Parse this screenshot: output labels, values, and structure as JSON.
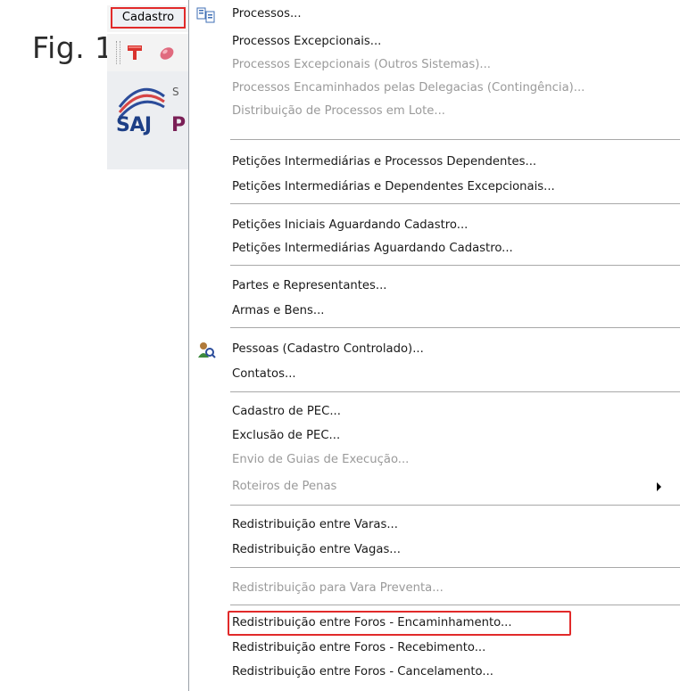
{
  "figure_label": "Fig. 1",
  "menubar": {
    "active_menu": "Cadastro"
  },
  "app": {
    "logo_text": "SAJ",
    "logo_side_s": "S",
    "logo_side_p": "P"
  },
  "dropdown": {
    "items": [
      {
        "label": "Processos...",
        "enabled": true,
        "icon": "process-list-icon"
      },
      {
        "label": "Processos Excepcionais...",
        "enabled": true
      },
      {
        "label": "Processos Excepcionais (Outros Sistemas)...",
        "enabled": false
      },
      {
        "label": "Processos Encaminhados pelas Delegacias (Contingência)...",
        "enabled": false
      },
      {
        "label": "Distribuição de Processos em Lote...",
        "enabled": false
      },
      {
        "label": "Petições Intermediárias e Processos Dependentes...",
        "enabled": true
      },
      {
        "label": "Petições Intermediárias e Dependentes Excepcionais...",
        "enabled": true
      },
      {
        "label": "Petições Iniciais Aguardando Cadastro...",
        "enabled": true
      },
      {
        "label": "Petições Intermediárias Aguardando Cadastro...",
        "enabled": true
      },
      {
        "label": "Partes e Representantes...",
        "enabled": true
      },
      {
        "label": "Armas e Bens...",
        "enabled": true
      },
      {
        "label": "Pessoas (Cadastro Controlado)...",
        "enabled": true,
        "icon": "person-search-icon"
      },
      {
        "label": "Contatos...",
        "enabled": true
      },
      {
        "label": "Cadastro de PEC...",
        "enabled": true
      },
      {
        "label": "Exclusão de PEC...",
        "enabled": true
      },
      {
        "label": "Envio de Guias de Execução...",
        "enabled": false
      },
      {
        "label": "Roteiros de Penas",
        "enabled": false,
        "submenu": true
      },
      {
        "label": "Redistribuição entre Varas...",
        "enabled": true
      },
      {
        "label": "Redistribuição entre Vagas...",
        "enabled": true
      },
      {
        "label": "Redistribuição para Vara Preventa...",
        "enabled": false
      },
      {
        "label": "Redistribuição entre Foros - Encaminhamento...",
        "enabled": true,
        "highlighted": true
      },
      {
        "label": "Redistribuição entre Foros - Recebimento...",
        "enabled": true
      },
      {
        "label": "Redistribuição entre Foros - Cancelamento...",
        "enabled": true
      }
    ]
  },
  "colors": {
    "highlight_border": "#e12a2a",
    "disabled_text": "#9a9a9a",
    "separator": "#a8a8a8"
  }
}
